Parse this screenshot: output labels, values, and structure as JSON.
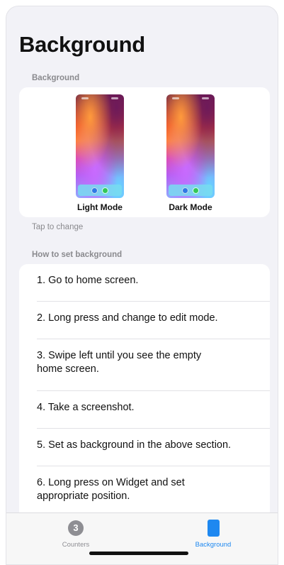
{
  "page": {
    "title": "Background"
  },
  "background_section": {
    "header": "Background",
    "previews": [
      {
        "label": "Light Mode"
      },
      {
        "label": "Dark Mode"
      }
    ],
    "footer": "Tap to change"
  },
  "instructions_section": {
    "header": "How to set background",
    "steps": [
      "1. Go to home screen.",
      "2. Long press and change to edit mode.",
      "3. Swipe left until you see the empty home screen.",
      "4. Take a screenshot.",
      "5. Set as background in the above section.",
      "6. Long press on Widget and set appropriate position."
    ]
  },
  "tab_bar": {
    "tabs": [
      {
        "label": "Counters",
        "badge": "3",
        "active": false,
        "icon": "counter-circle-icon"
      },
      {
        "label": "Background",
        "active": true,
        "icon": "phone-rectangle-icon"
      }
    ]
  },
  "colors": {
    "accent": "#1e88f0",
    "inactive": "#8e8e93",
    "background": "#f2f2f7"
  }
}
